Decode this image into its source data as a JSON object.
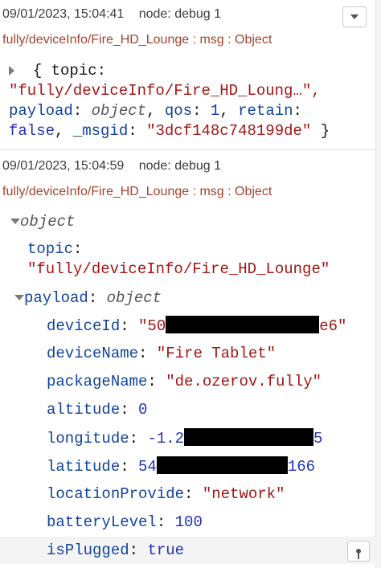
{
  "dropdown_icon": "chevron-down-icon",
  "pin_icon": "pin-icon",
  "message1": {
    "timestamp": "09/01/2023, 15:04:41",
    "node": "node: debug 1",
    "topic_line": "fully/deviceInfo/Fire_HD_Lounge : msg : Object",
    "line1": "{ topic:",
    "line2": "\"fully/deviceInfo/Fire_HD_Loung…\",",
    "line3_key1": "payload",
    "line3_val1": "object",
    "line3_key2": "qos",
    "line3_val2": "1",
    "line3_key3": "retain",
    "line4_val": "false",
    "line4_key": "_msgid",
    "line4_str": "\"3dcf148c748199de\"",
    "line4_end": "}"
  },
  "message2": {
    "timestamp": "09/01/2023, 15:04:59",
    "node": "node: debug 1",
    "topic_line": "fully/deviceInfo/Fire_HD_Lounge : msg : Object",
    "root_label": "object",
    "topic_key": "topic",
    "topic_value": "\"fully/deviceInfo/Fire_HD_Lounge\"",
    "payload_key": "payload",
    "payload_type": "object",
    "fields": {
      "deviceId": {
        "key": "deviceId",
        "pre": "\"50",
        "post": "e6\""
      },
      "deviceName": {
        "key": "deviceName",
        "value": "\"Fire Tablet\""
      },
      "packageName": {
        "key": "packageName",
        "value": "\"de.ozerov.fully\""
      },
      "altitude": {
        "key": "altitude",
        "value": "0"
      },
      "longitude": {
        "key": "longitude",
        "pre": "-1.2",
        "post": "5"
      },
      "latitude": {
        "key": "latitude",
        "pre": "54",
        "post": "166"
      },
      "locationProvide": {
        "key": "locationProvide",
        "value": "\"network\""
      },
      "batteryLevel": {
        "key": "batteryLevel",
        "value": "100"
      },
      "isPlugged": {
        "key": "isPlugged",
        "value": "true"
      }
    }
  }
}
